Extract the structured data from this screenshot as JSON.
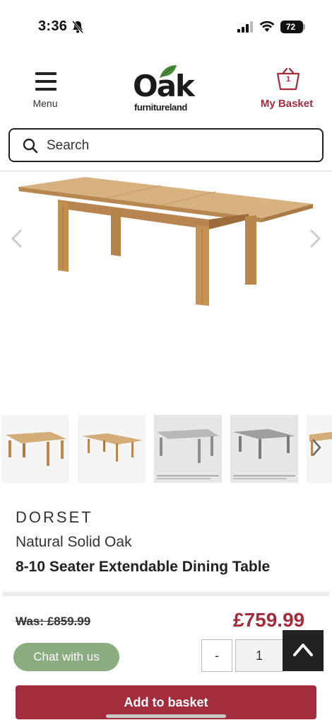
{
  "status_bar": {
    "time": "3:36",
    "battery": "72",
    "icons": [
      "bell-slash-icon",
      "signal-icon",
      "wifi-icon",
      "battery-icon"
    ]
  },
  "header": {
    "menu_label": "Menu",
    "logo_main": "Oak",
    "logo_sub": "furnitureland",
    "basket_count": "1",
    "basket_label": "My Basket"
  },
  "search": {
    "placeholder": "Search"
  },
  "product": {
    "brand": "DORSET",
    "subtitle": "Natural Solid Oak",
    "title": "8-10 Seater Extendable Dining Table",
    "was_price": "Was: £859.99",
    "price": "£759.99",
    "quantity": "1",
    "thumbnail_count": 5
  },
  "actions": {
    "chat_label": "Chat with us",
    "qty_minus": "-",
    "add_to_basket": "Add to basket"
  },
  "colors": {
    "brand_red": "#a32d3c",
    "chat_green": "#8aac7f",
    "oak": "#c89a62"
  }
}
